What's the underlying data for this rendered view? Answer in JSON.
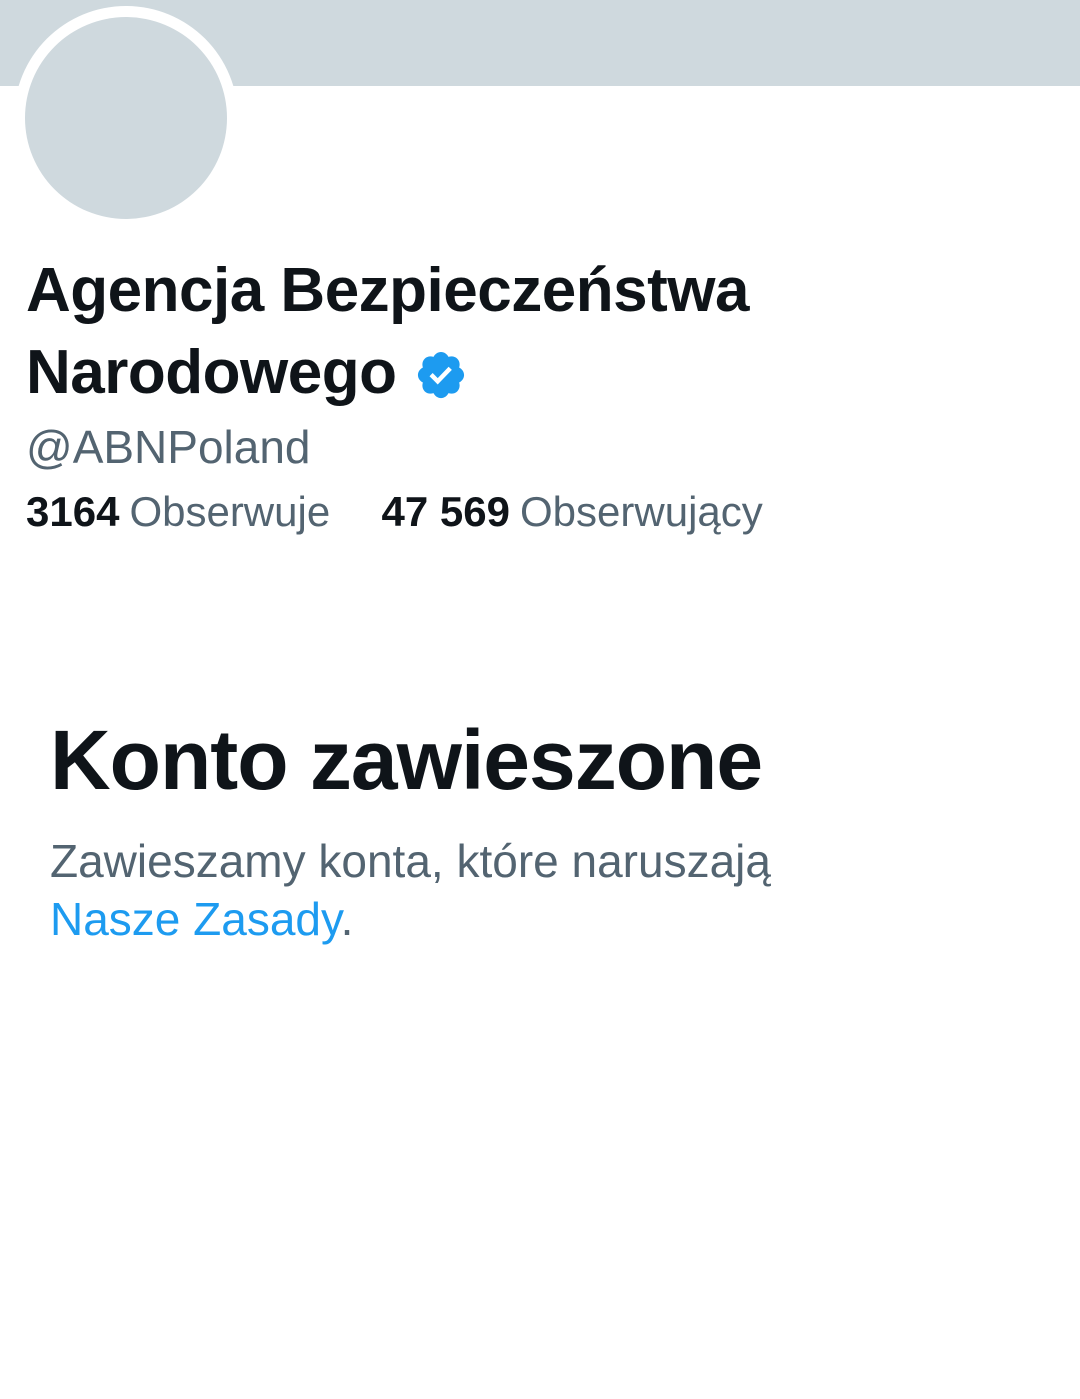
{
  "profile": {
    "name_line1": "Agencja Bezpieczeństwa",
    "name_line2": "Narodowego",
    "handle": "@ABNPoland",
    "verified_icon": "verified-badge-icon",
    "following_count": "3164",
    "following_label": "Obserwuje",
    "followers_count": "47 569",
    "followers_label": "Obserwujący"
  },
  "suspension": {
    "title": "Konto zawieszone",
    "description": "Zawieszamy konta, które naruszają",
    "rules_link": "Nasze Zasady",
    "period": "."
  },
  "colors": {
    "banner": "#cfd9de",
    "avatar_placeholder": "#cfd9de",
    "text_primary": "#0f1419",
    "text_secondary": "#536471",
    "link": "#1d9bf0",
    "verified": "#1d9bf0"
  }
}
